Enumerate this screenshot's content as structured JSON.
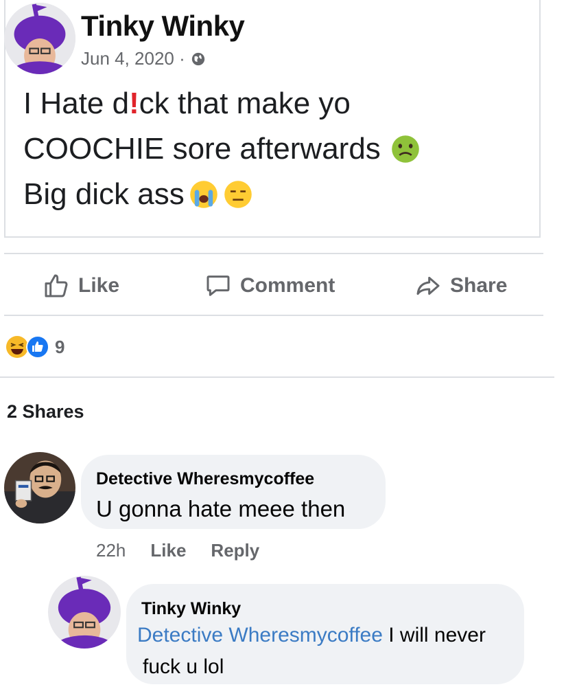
{
  "post": {
    "author": "Tinky Winky",
    "date": "Jun 4, 2020 ·",
    "text_line1": "I Hate d!ck that make yo",
    "text_line2": "COOCHIE sore afterwards",
    "text_line3": "Big dick ass",
    "emojis": [
      "nauseated-face",
      "loudly-crying-face",
      "expressionless-face"
    ]
  },
  "actions": {
    "like": "Like",
    "comment": "Comment",
    "share": "Share"
  },
  "reactions": {
    "icons": [
      "laughing-face-icon",
      "thumbs-up-icon"
    ],
    "count": "9"
  },
  "shares": "2 Shares",
  "comments": [
    {
      "author": "Detective Wheresmycoffee",
      "text": "U gonna hate meee then",
      "time": "22h",
      "like": "Like",
      "reply": "Reply"
    }
  ],
  "reply": {
    "author": "Tinky Winky",
    "mention": "Detective Wheresmycoffee",
    "text_after_mention": " I will never",
    "text_line2": "fuck u lol"
  },
  "colors": {
    "accent": "#1877f2",
    "mention": "#3b7bc4",
    "muted": "#65676b",
    "bubble": "#f0f2f5",
    "purple": "#6a2bb8"
  }
}
